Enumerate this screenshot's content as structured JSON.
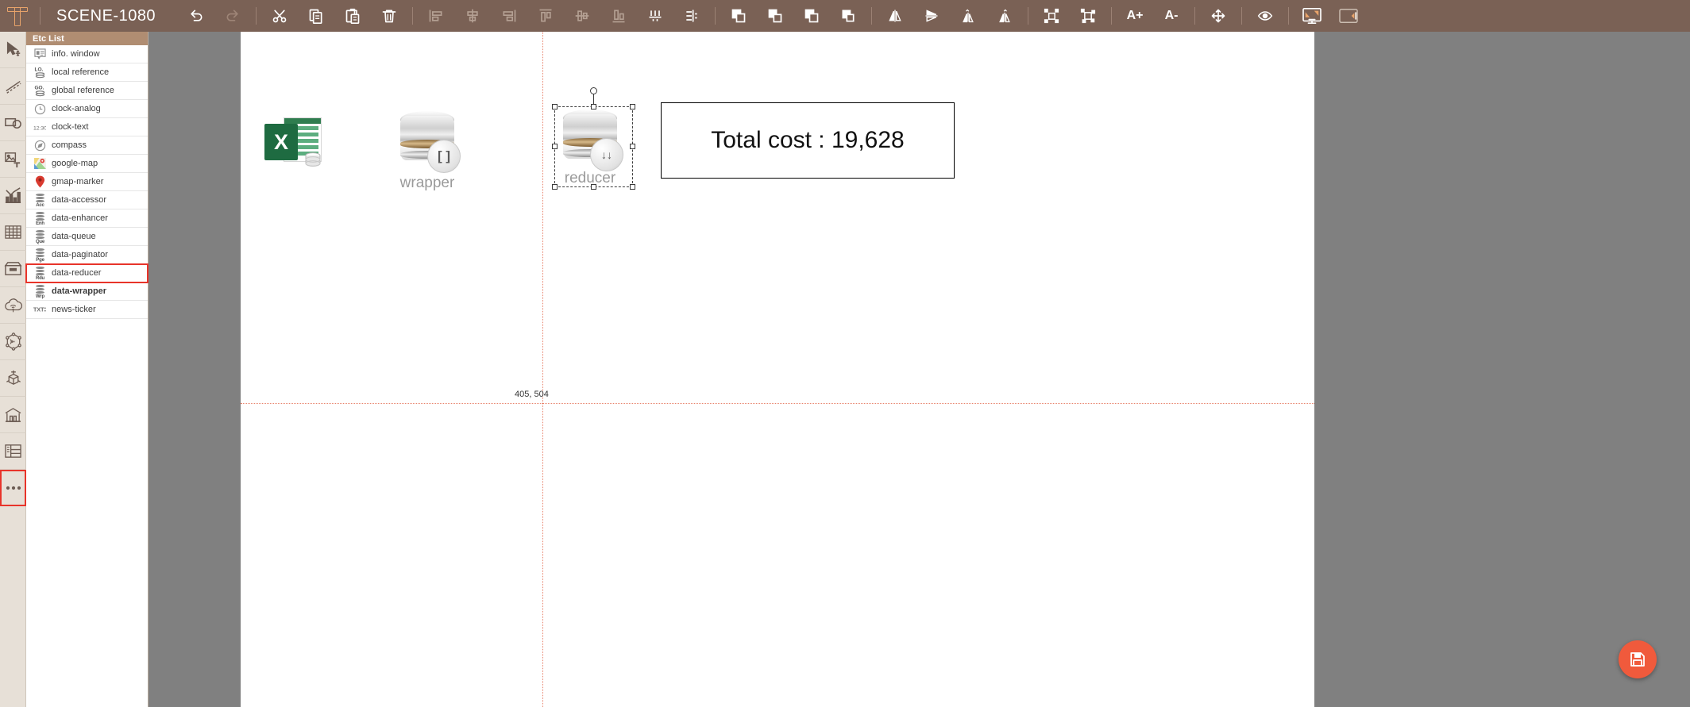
{
  "topbar": {
    "logo": "t-logo-icon",
    "title": "SCENE-1080",
    "buttons": [
      {
        "name": "undo-button",
        "icon": "undo-icon",
        "state": "enabled"
      },
      {
        "name": "redo-button",
        "icon": "redo-icon",
        "state": "disabled"
      },
      {
        "name": "cut-button",
        "icon": "scissors-icon",
        "state": "enabled"
      },
      {
        "name": "copy-button",
        "icon": "copy-icon",
        "state": "enabled"
      },
      {
        "name": "paste-button",
        "icon": "paste-icon",
        "state": "enabled"
      },
      {
        "name": "delete-button",
        "icon": "trash-icon",
        "state": "enabled"
      },
      {
        "name": "align-left-button",
        "icon": "align-left-icon",
        "state": "disabled"
      },
      {
        "name": "align-center-horizontal-button",
        "icon": "align-center-horizontal-icon",
        "state": "disabled"
      },
      {
        "name": "align-right-button",
        "icon": "align-right-icon",
        "state": "disabled"
      },
      {
        "name": "align-top-button",
        "icon": "align-top-icon",
        "state": "disabled"
      },
      {
        "name": "align-middle-vertical-button",
        "icon": "align-middle-vertical-icon",
        "state": "disabled"
      },
      {
        "name": "align-bottom-button",
        "icon": "align-bottom-icon",
        "state": "disabled"
      },
      {
        "name": "distribute-horizontal-button",
        "icon": "distribute-horizontal-icon",
        "state": "enabled"
      },
      {
        "name": "distribute-vertical-button",
        "icon": "distribute-vertical-icon",
        "state": "enabled"
      },
      {
        "name": "bring-to-front-button",
        "icon": "bring-to-front-icon",
        "state": "enabled"
      },
      {
        "name": "bring-forward-button",
        "icon": "bring-forward-icon",
        "state": "enabled"
      },
      {
        "name": "send-backward-button",
        "icon": "send-backward-icon",
        "state": "enabled"
      },
      {
        "name": "send-to-back-button",
        "icon": "send-to-back-icon",
        "state": "enabled"
      },
      {
        "name": "flip-horizontal-button",
        "icon": "flip-horizontal-icon",
        "state": "enabled"
      },
      {
        "name": "flip-vertical-button",
        "icon": "flip-vertical-icon",
        "state": "enabled"
      },
      {
        "name": "rotate-left-button",
        "icon": "rotate-left-icon",
        "state": "enabled"
      },
      {
        "name": "rotate-right-button",
        "icon": "rotate-right-icon",
        "state": "enabled"
      },
      {
        "name": "group-button",
        "icon": "group-icon",
        "state": "enabled"
      },
      {
        "name": "ungroup-button",
        "icon": "ungroup-icon",
        "state": "enabled"
      },
      {
        "name": "font-increase-button",
        "icon": "font-increase-icon",
        "label": "A+",
        "state": "enabled"
      },
      {
        "name": "font-decrease-button",
        "icon": "font-decrease-icon",
        "label": "A-",
        "state": "enabled"
      },
      {
        "name": "move-button",
        "icon": "move-icon",
        "state": "enabled"
      },
      {
        "name": "visibility-button",
        "icon": "eye-icon",
        "state": "enabled"
      },
      {
        "name": "preview-button",
        "icon": "monitor-icon",
        "state": "enabled"
      },
      {
        "name": "toggle-panel-button",
        "icon": "panel-toggle-icon",
        "state": "enabled"
      }
    ],
    "font_increase_label": "A+",
    "font_decrease_label": "A-"
  },
  "rail": {
    "items": [
      {
        "name": "select-tool",
        "icon": "cursor-move-icon"
      },
      {
        "name": "line-tool",
        "icon": "dashed-line-icon"
      },
      {
        "name": "shape-tool",
        "icon": "rect-circle-icon"
      },
      {
        "name": "image-text-tool",
        "icon": "image-text-icon"
      },
      {
        "name": "chart-tool",
        "icon": "bar-chart-icon"
      },
      {
        "name": "table-tool",
        "icon": "table-grid-icon"
      },
      {
        "name": "box-tool",
        "icon": "archive-box-icon"
      },
      {
        "name": "cloud-tool",
        "icon": "cloud-wifi-icon"
      },
      {
        "name": "network-tool",
        "icon": "sensor-network-icon"
      },
      {
        "name": "cube-tool",
        "icon": "cube-3d-icon"
      },
      {
        "name": "facility-tool",
        "icon": "factory-icon"
      },
      {
        "name": "layout-tool",
        "icon": "layout-panel-icon"
      },
      {
        "name": "more-tools",
        "icon": "ellipsis-icon",
        "selected": true
      }
    ]
  },
  "panel": {
    "header": "Etc List",
    "items": [
      {
        "label": "info. window",
        "icon": "info-window-icon",
        "selected": false,
        "bold": false
      },
      {
        "label": "local reference",
        "icon": "local-reference-icon",
        "abbr": "LO.",
        "selected": false,
        "bold": false
      },
      {
        "label": "global reference",
        "icon": "global-reference-icon",
        "abbr": "GO.",
        "selected": false,
        "bold": false
      },
      {
        "label": "clock-analog",
        "icon": "clock-analog-icon",
        "selected": false,
        "bold": false
      },
      {
        "label": "clock-text",
        "icon": "clock-text-icon",
        "abbr": "12:30",
        "selected": false,
        "bold": false
      },
      {
        "label": "compass",
        "icon": "compass-icon",
        "selected": false,
        "bold": false
      },
      {
        "label": "google-map",
        "icon": "google-map-icon",
        "selected": false,
        "bold": false
      },
      {
        "label": "gmap-marker",
        "icon": "gmap-marker-icon",
        "selected": false,
        "bold": false
      },
      {
        "label": "data-accessor",
        "icon": "database-icon",
        "abbr": "Acc",
        "selected": false,
        "bold": false
      },
      {
        "label": "data-enhancer",
        "icon": "database-icon",
        "abbr": "Enh",
        "selected": false,
        "bold": false
      },
      {
        "label": "data-queue",
        "icon": "database-icon",
        "abbr": "Que",
        "selected": false,
        "bold": false
      },
      {
        "label": "data-paginator",
        "icon": "database-icon",
        "abbr": "Pge",
        "selected": false,
        "bold": false
      },
      {
        "label": "data-reducer",
        "icon": "database-icon",
        "abbr": "Rdu",
        "selected": true,
        "bold": false
      },
      {
        "label": "data-wrapper",
        "icon": "database-icon",
        "abbr": "Wrp",
        "selected": false,
        "bold": true
      },
      {
        "label": "news-ticker",
        "icon": "news-ticker-icon",
        "abbr": "TXT",
        "selected": false,
        "bold": false
      }
    ]
  },
  "canvas": {
    "coordinate_label": "405, 504",
    "objects": [
      {
        "name": "excel-data-object",
        "caption": ""
      },
      {
        "name": "wrapper-object",
        "caption": "wrapper",
        "badge": "[ ]"
      },
      {
        "name": "reducer-object",
        "caption": "reducer",
        "badge": "↓↓",
        "selected": true
      },
      {
        "name": "total-cost-textbox",
        "text": "Total cost : 19,628"
      }
    ],
    "total_cost_text": "Total cost : 19,628",
    "wrapper_caption": "wrapper",
    "reducer_caption": "reducer",
    "wrapper_badge": "[ ]",
    "reducer_badge": "↓↓"
  },
  "fab": {
    "name": "save-button",
    "icon": "save-disk-icon"
  },
  "colors": {
    "topbar": "#7a6155",
    "panel_header": "#b08d72",
    "rail_bg": "#e7e0d7",
    "selection_red": "#e8342a",
    "guide": "#e8836c",
    "fab": "#f05a3c",
    "canvas_bg": "#808080"
  }
}
